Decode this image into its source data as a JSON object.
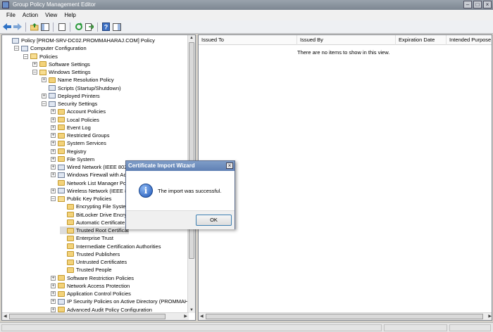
{
  "window": {
    "title": "Group Policy Management Editor",
    "minimize_glyph": "–",
    "maximize_glyph": "□",
    "close_glyph": "×"
  },
  "menubar": {
    "items": [
      "File",
      "Action",
      "View",
      "Help"
    ]
  },
  "toolbar": {
    "buttons": [
      "back-arrow-icon",
      "forward-arrow-icon",
      "up-folder-icon",
      "show-hide-tree-icon",
      "properties-icon",
      "refresh-icon",
      "export-list-icon",
      "help-icon",
      "show-hide-action-pane-icon"
    ]
  },
  "tree": {
    "items": [
      {
        "label": "Policy [PROM-SRV-DC02.PROMMAHARAJ.COM] Policy",
        "expander": ""
      },
      {
        "label": "Computer Configuration",
        "expander": "–"
      },
      {
        "label": "Policies",
        "expander": "–"
      },
      {
        "label": "Software Settings",
        "expander": "+"
      },
      {
        "label": "Windows Settings",
        "expander": "–"
      },
      {
        "label": "Name Resolution Policy",
        "expander": "+"
      },
      {
        "label": "Scripts (Startup/Shutdown)",
        "expander": ""
      },
      {
        "label": "Deployed Printers",
        "expander": "+"
      },
      {
        "label": "Security Settings",
        "expander": "–"
      },
      {
        "label": "Account Policies",
        "expander": "+"
      },
      {
        "label": "Local Policies",
        "expander": "+"
      },
      {
        "label": "Event Log",
        "expander": "+"
      },
      {
        "label": "Restricted Groups",
        "expander": "+"
      },
      {
        "label": "System Services",
        "expander": "+"
      },
      {
        "label": "Registry",
        "expander": "+"
      },
      {
        "label": "File System",
        "expander": "+"
      },
      {
        "label": "Wired Network (IEEE 802.3",
        "expander": "+"
      },
      {
        "label": "Windows Firewall with Adva",
        "expander": "+"
      },
      {
        "label": "Network List Manager Polic",
        "expander": ""
      },
      {
        "label": "Wireless Network (IEEE 802",
        "expander": "+"
      },
      {
        "label": "Public Key Policies",
        "expander": "–"
      },
      {
        "label": "Encrypting File System",
        "expander": ""
      },
      {
        "label": "BitLocker Drive Encrypt",
        "expander": ""
      },
      {
        "label": "Automatic Certificate R",
        "expander": ""
      },
      {
        "label": "Trusted Root Certificat",
        "expander": ""
      },
      {
        "label": "Enterprise Trust",
        "expander": ""
      },
      {
        "label": "Intermediate Certification Authorities",
        "expander": ""
      },
      {
        "label": "Trusted Publishers",
        "expander": ""
      },
      {
        "label": "Untrusted Certificates",
        "expander": ""
      },
      {
        "label": "Trusted People",
        "expander": ""
      },
      {
        "label": "Software Restriction Policies",
        "expander": "+"
      },
      {
        "label": "Network Access Protection",
        "expander": "+"
      },
      {
        "label": "Application Control Policies",
        "expander": "+"
      },
      {
        "label": "IP Security Policies on Active Directory (PROMMAHAR",
        "expander": "+"
      },
      {
        "label": "Advanced Audit Policy Configuration",
        "expander": "+"
      }
    ]
  },
  "list": {
    "columns": [
      "Issued To",
      "Issued By",
      "Expiration Date",
      "Intended Purpose"
    ],
    "empty_message": "There are no items to show in this view."
  },
  "dialog": {
    "title": "Certificate Import Wizard",
    "close_glyph": "×",
    "icon_glyph": "i",
    "message": "The import was successful.",
    "ok_label": "OK"
  }
}
